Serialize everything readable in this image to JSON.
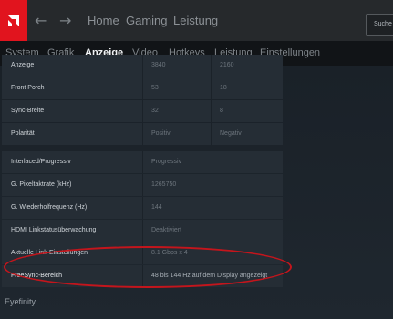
{
  "top_nav": {
    "home": "Home",
    "gaming": "Gaming",
    "leistung": "Leistung",
    "search_text": "Suche"
  },
  "tabs": [
    {
      "label": "System"
    },
    {
      "label": "Grafik"
    },
    {
      "label": "Anzeige"
    },
    {
      "label": "Video"
    },
    {
      "label": "Hotkeys"
    },
    {
      "label": "Leistung"
    },
    {
      "label": "Einstellungen"
    }
  ],
  "timing_table": [
    {
      "label": "Anzeige",
      "v1": "3840",
      "v2": "2160"
    },
    {
      "label": "Front Porch",
      "v1": "53",
      "v2": "18"
    },
    {
      "label": "Sync-Breite",
      "v1": "32",
      "v2": "8"
    },
    {
      "label": "Polarität",
      "v1": "Positiv",
      "v2": "Negativ"
    }
  ],
  "info_table": [
    {
      "label": "Interlaced/Progressiv",
      "value": "Progressiv"
    },
    {
      "label": "G. Pixeltaktrate (kHz)",
      "value": "1265750"
    },
    {
      "label": "G. Wiederholfrequenz (Hz)",
      "value": "144"
    },
    {
      "label": "HDMI Linkstatusüberwachung",
      "value": "Deaktiviert"
    },
    {
      "label": "Aktuelle Link-Einstellungen",
      "value": "8.1 Gbps x 4"
    },
    {
      "label": "FreeSync-Bereich",
      "value": "48 bis 144 Hz auf dem Display angezeigt"
    }
  ],
  "section_eyefinity": "Eyefinity",
  "colors": {
    "accent": "#e1141e",
    "background": "#1b2229"
  }
}
